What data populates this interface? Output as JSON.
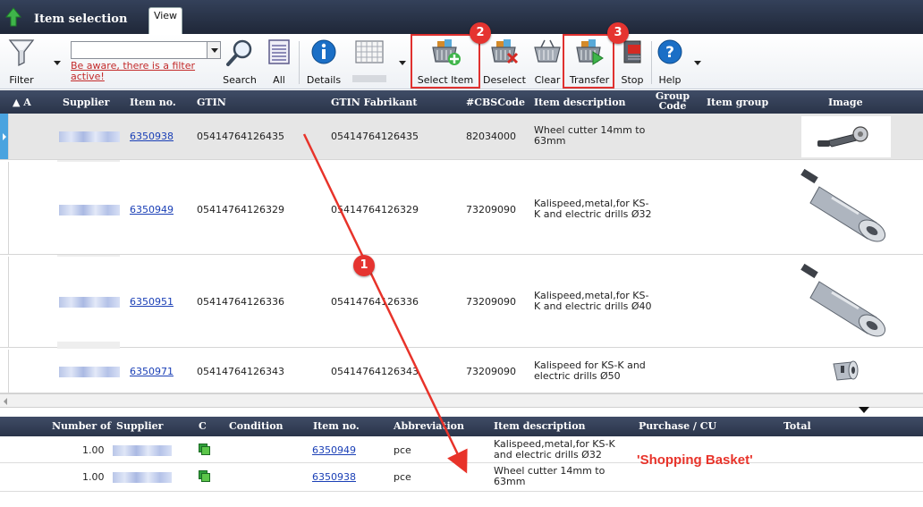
{
  "app": {
    "title": "Item selection",
    "tab_view": "View"
  },
  "toolbar": {
    "filter_label": "Filter",
    "filter_value": "",
    "filter_warning": "Be aware, there is a filter active!",
    "search_label": "Search",
    "all_label": "All",
    "details_label": "Details",
    "select_item_label": "Select Item",
    "deselect_label": "Deselect",
    "clear_label": "Clear",
    "transfer_label": "Transfer",
    "stop_label": "Stop",
    "help_label": "Help"
  },
  "badges": {
    "one": "1",
    "two": "2",
    "three": "3"
  },
  "grid": {
    "columns": {
      "sort": "A",
      "supplier": "Supplier",
      "item_no": "Item no.",
      "gtin": "GTIN",
      "gtin_fabrikant": "GTIN Fabrikant",
      "cbs_code": "#CBSCode",
      "item_description": "Item description",
      "group_code": "Group Code",
      "item_group": "Item group",
      "image": "Image"
    },
    "rows": [
      {
        "item_no": "6350938",
        "gtin": "05414764126435",
        "gtin_fabrikant": "05414764126435",
        "cbs_code": "82034000",
        "description": "Wheel cutter 14mm to 63mm",
        "image": "wheel-cutter-image"
      },
      {
        "item_no": "6350949",
        "gtin": "05414764126329",
        "gtin_fabrikant": "05414764126329",
        "cbs_code": "73209090",
        "description": "Kalispeed,metal,for KS-K and electric drills Ø32",
        "image": "kalispeed-tool-image"
      },
      {
        "item_no": "6350951",
        "gtin": "05414764126336",
        "gtin_fabrikant": "05414764126336",
        "cbs_code": "73209090",
        "description": "Kalispeed,metal,for KS-K and electric drills Ø40",
        "image": "kalispeed-tool-image"
      },
      {
        "item_no": "6350971",
        "gtin": "05414764126343",
        "gtin_fabrikant": "05414764126343",
        "cbs_code": "73209090",
        "description": "Kalispeed for KS-K and electric drills Ø50",
        "image": "kalispeed-bit-image"
      }
    ]
  },
  "basket": {
    "columns": {
      "number_of": "Number of",
      "supplier": "Supplier",
      "c": "C",
      "condition": "Condition",
      "item_no": "Item no.",
      "abbreviation": "Abbreviation",
      "item_description": "Item description",
      "purchase_cu": "Purchase / CU",
      "total": "Total"
    },
    "rows": [
      {
        "number_of": "1.00",
        "item_no": "6350949",
        "abbreviation": "pce",
        "description": "Kalispeed,metal,for KS-K and electric drills Ø32"
      },
      {
        "number_of": "1.00",
        "item_no": "6350938",
        "abbreviation": "pce",
        "description": "Wheel cutter 14mm to 63mm"
      }
    ],
    "annotation": "'Shopping Basket'"
  },
  "colors": {
    "header": "#2f3a52",
    "accent_red": "#e53430",
    "link": "#1a3fb6"
  }
}
